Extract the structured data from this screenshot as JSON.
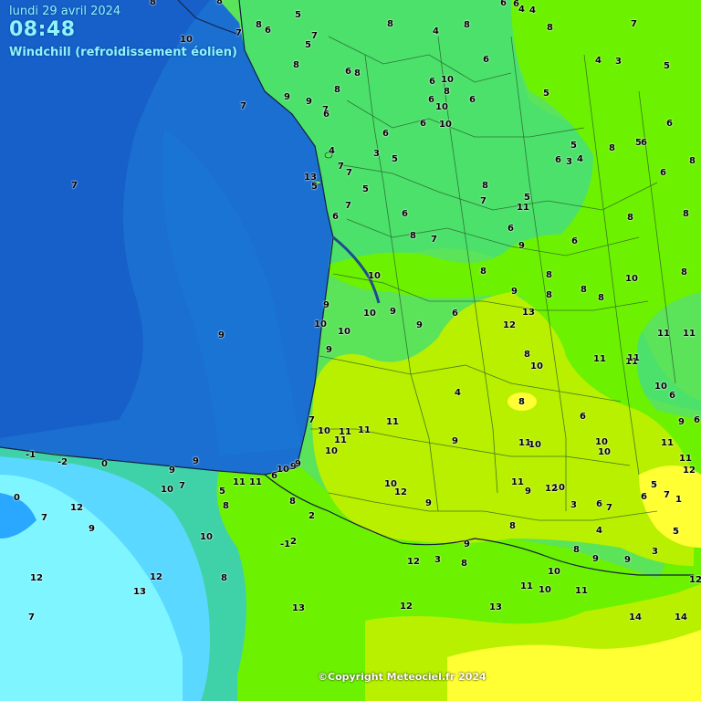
{
  "header": {
    "date": "lundi 29 avril 2024",
    "time": "08:48",
    "title": "Windchill (refroidissement éolien)"
  },
  "copyright": "©Copyright Meteociel.fr 2024",
  "colors": {
    "ocean_deep": "#1656c4",
    "ocean": "#1a6fd0",
    "band_cold": "#5ad8ff",
    "band_m2": "#7ff6ff",
    "band_2_4": "#3fd2a8",
    "band_4_6": "#3ee07a",
    "band_6_8": "#5be35a",
    "band_8_10": "#6cf200",
    "band_10_12": "#b8f000",
    "band_12_14": "#ffff33"
  },
  "observations": [
    "8",
    "6",
    "6",
    "4",
    "4",
    "10",
    "8",
    "7",
    "5",
    "7",
    "8",
    "4",
    "8",
    "8",
    "7",
    "8",
    "6",
    "5",
    "8",
    "6",
    "8",
    "6",
    "4",
    "3",
    "5",
    "8",
    "9",
    "9",
    "10",
    "6",
    "8",
    "6",
    "10",
    "6",
    "5",
    "7",
    "6",
    "7",
    "6",
    "10",
    "6",
    "6",
    "5",
    "6",
    "5",
    "3",
    "5",
    "6",
    "3",
    "4",
    "8",
    "8",
    "4",
    "7",
    "6",
    "7",
    "13",
    "5",
    "5",
    "8",
    "5",
    "6",
    "7",
    "6",
    "7",
    "11",
    "8",
    "8",
    "7",
    "6",
    "8",
    "7",
    "6",
    "9",
    "10",
    "8",
    "8",
    "8",
    "10",
    "9",
    "8",
    "8",
    "8",
    "9",
    "10",
    "9",
    "6",
    "13",
    "9",
    "10",
    "10",
    "12",
    "9",
    "11",
    "11",
    "9",
    "8",
    "10",
    "11",
    "11",
    "11",
    "10",
    "6",
    "4",
    "8",
    "6",
    "9",
    "6",
    "7",
    "11",
    "11",
    "11",
    "10",
    "11",
    "9",
    "11",
    "10",
    "10",
    "10",
    "10",
    "11",
    "11",
    "12",
    "-1",
    "-2",
    "0",
    "0",
    "7",
    "12",
    "9",
    "9",
    "9",
    "11",
    "11",
    "10",
    "6",
    "9",
    "9",
    "10",
    "7",
    "5",
    "8",
    "10",
    "12",
    "9",
    "11",
    "10",
    "12",
    "9",
    "8",
    "2",
    "3",
    "6",
    "7",
    "6",
    "5",
    "7",
    "1",
    "4",
    "5",
    "8",
    "10",
    "-1",
    "2",
    "9",
    "8",
    "3",
    "9",
    "9",
    "11",
    "10",
    "12",
    "3",
    "8",
    "8",
    "12",
    "13",
    "12",
    "10",
    "11",
    "12",
    "12",
    "13",
    "13",
    "14",
    "14",
    "7"
  ],
  "map_layers": {
    "coast": "French Atlantic coastline",
    "borders": "department boundaries"
  }
}
